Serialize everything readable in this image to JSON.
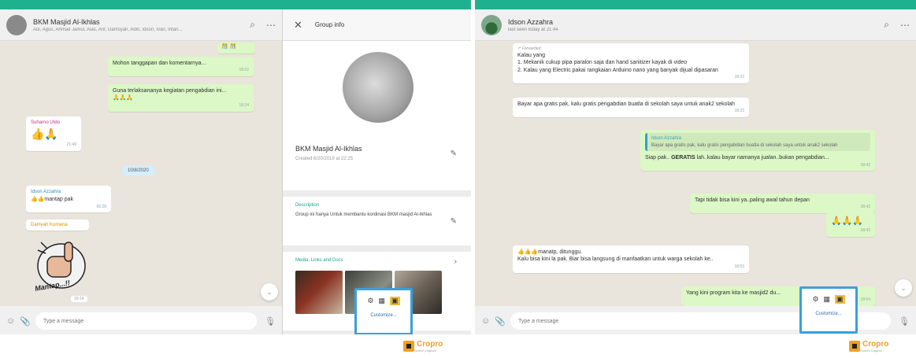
{
  "left": {
    "header": {
      "title": "BKM Masjid Al-Ikhlas",
      "subtitle": "Adi, Agus, Ahmad Jamul, Alas, Arif, Damsyah, Aditi, Idson, Ivan, Intan..."
    },
    "top_snippet": "🎊 🎊",
    "messages": [
      {
        "text": "Mohon tanggapan dan komentarnya...",
        "time": "18:22"
      },
      {
        "text": "Guna terlaksananya kegiatan pengabdian ini...",
        "emoji": "🙏🙏🙏",
        "time": "18:24"
      },
      {
        "sender": "Suharno Utdo",
        "emoji": "👍🙏",
        "time": "21:49"
      },
      {
        "date": "10/8/2020"
      },
      {
        "sender": "Idson Azzahra",
        "text": "👍👍mantap pak",
        "time": "06:28"
      },
      {
        "sender": "Damyah Kurnena",
        "sticker_text": "Mantap...!!",
        "time": "10:14"
      }
    ],
    "input_placeholder": "Type a message"
  },
  "info": {
    "header_title": "Group info",
    "group_name": "BKM Masjid Al-Ikhlas",
    "created": "Created 6/20/2019 at 22:25",
    "description_label": "Description",
    "description": "Group ini hanya Untuk membantu kordinasi BKM masjid Al-Ikhlas",
    "media_label": "Media, Links and Docs"
  },
  "popup_link": "Customize...",
  "right": {
    "header": {
      "title": "Idson Azzahra",
      "subtitle": "last seen today at 21:44"
    },
    "messages": [
      {
        "forwarded": "Forwarded",
        "lines": [
          "Kalau yang",
          "1. Mekanik cukup pipa paralon saja dan hand sanitizer kayak di video",
          "2. Kalau yang Electric pakai rangkaian Arduino nano yang banyak dijual dipasaran"
        ],
        "time": "18:22"
      },
      {
        "text": "Bayar apa gratis pak, kalu gratis pengabdian buatla di sekolah saya untuk anak2 sekolah",
        "time": "18:23"
      },
      {
        "quote_sender": "Idson Azzahra",
        "quote_text": "Bayar apa gratis pak, kalu gratis pengabdian buatla di sekolah saya untuk anak2 sekolah",
        "text_before": "Siap pak.. ",
        "text_bold": "GERATIS",
        "text_after": " lah..kalau bayar namanya jualan..bukan pengabdian...",
        "time": "18:42"
      },
      {
        "text": "Tapi tidak bisa kini ya..paling awal tahun depan",
        "time": "18:42"
      },
      {
        "emoji": "🙏🙏🙏",
        "time": "18:42"
      },
      {
        "text": "👍👍👍manatp, ditunggu.",
        "text2": "Kalu bisa kini la pak. Biar bisa langsung di manfaatkan untuk warga sekolah ke..",
        "time": "18:53"
      },
      {
        "text": "Yang kini program kita ke masjid2 du...",
        "time": "18:54"
      }
    ],
    "input_placeholder": "Type a message"
  },
  "logo": {
    "name": "Cropro",
    "tag": "Screen Capture"
  }
}
